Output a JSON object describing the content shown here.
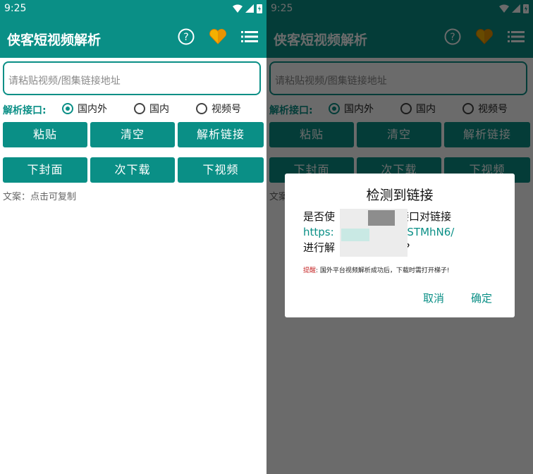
{
  "status": {
    "time": "9:25"
  },
  "app": {
    "title": "侠客短视频解析"
  },
  "input": {
    "placeholder": "请粘贴视频/图集链接地址"
  },
  "interface": {
    "label": "解析接口:",
    "options": [
      "国内外",
      "国内",
      "视频号"
    ],
    "selected": "国内外"
  },
  "buttons": {
    "row1": [
      "粘贴",
      "清空",
      "解析链接"
    ],
    "row2": [
      "下封面",
      "次下载",
      "下视频"
    ]
  },
  "caption": "文案：点击可复制",
  "dialog": {
    "title": "检测到链接",
    "line1": "是否使",
    "line1b": "接口对链接",
    "line2": "https:",
    "line2b": "/kSTMhN6/",
    "line3": "进行解",
    "line3b": "F?",
    "note_tag": "提醒",
    "note": ": 国外平台视频解析成功后，下载时需打开梯子!",
    "cancel": "取消",
    "confirm": "确定"
  },
  "colors": {
    "primary": "#0a8f86",
    "heart": "#f5b000"
  }
}
